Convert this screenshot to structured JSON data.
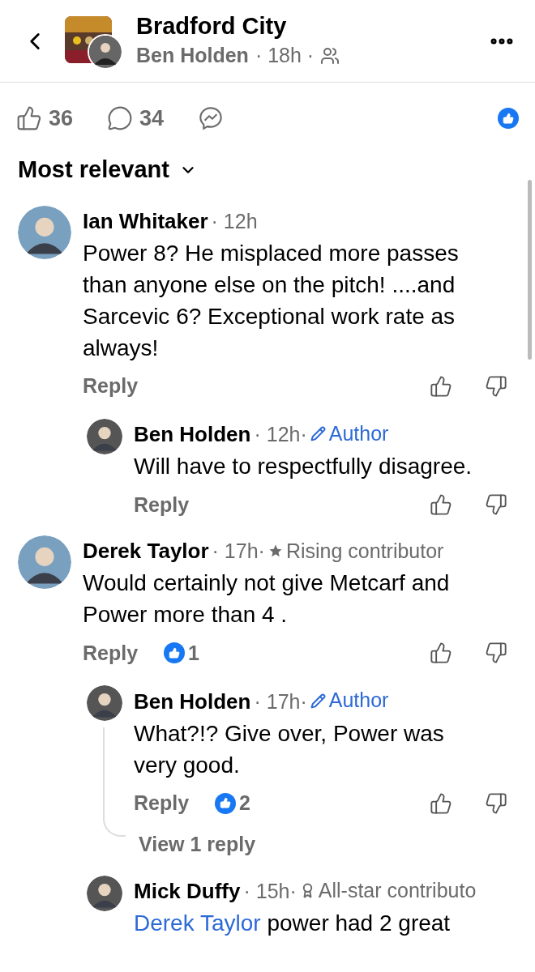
{
  "header": {
    "group_name": "Bradford City",
    "author": "Ben Holden",
    "time": "· 18h ·"
  },
  "stats": {
    "likes": "36",
    "comments": "34",
    "liked": true
  },
  "sort": {
    "label": "Most relevant"
  },
  "comments": [
    {
      "name": "Ian Whitaker",
      "time": "· 12h",
      "text": "Power 8? He misplaced more passes than anyone else on the pitch! ....and Sarcevic 6? Exceptional work rate as always!",
      "reply": "Reply",
      "children": [
        {
          "name": "Ben Holden",
          "time": "· 12h·",
          "badge": {
            "kind": "author",
            "label": "Author"
          },
          "text": "Will have to respectfully disagree.",
          "reply": "Reply"
        }
      ]
    },
    {
      "name": "Derek Taylor",
      "time": "· 17h·",
      "badge": {
        "kind": "rising",
        "label": "Rising contributor"
      },
      "text": "Would  certainly  not give Metcarf and Power more than 4  .",
      "reply": "Reply",
      "reactions": "1",
      "children": [
        {
          "name": "Ben Holden",
          "time": "· 17h·",
          "badge": {
            "kind": "author",
            "label": "Author"
          },
          "text": "What?!? Give over, Power was very good.",
          "reply": "Reply",
          "reactions": "2",
          "more": "View 1 reply"
        },
        {
          "name": "Mick Duffy",
          "time": "· 15h·",
          "badge": {
            "kind": "allstar",
            "label": "All-star contributo"
          },
          "mention": "Derek Taylor",
          "text": "power had 2 great"
        }
      ]
    }
  ]
}
